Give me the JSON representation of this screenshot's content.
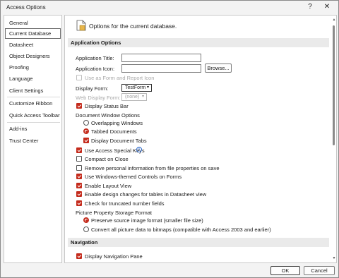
{
  "window": {
    "title": "Access Options",
    "help": "?",
    "close": "✕"
  },
  "sidebar": {
    "items": [
      {
        "label": "General"
      },
      {
        "label": "Current Database"
      },
      {
        "label": "Datasheet"
      },
      {
        "label": "Object Designers"
      },
      {
        "label": "Proofing"
      },
      {
        "label": "Language"
      },
      {
        "label": "Client Settings"
      },
      {
        "label": "Customize Ribbon"
      },
      {
        "label": "Quick Access Toolbar"
      },
      {
        "label": "Add-ins"
      },
      {
        "label": "Trust Center"
      }
    ],
    "active": "Current Database"
  },
  "header": {
    "text": "Options for the current database."
  },
  "app_options": {
    "heading": "Application Options",
    "app_title_label": "Application Title:",
    "app_title_value": "",
    "app_icon_label": "Application Icon:",
    "app_icon_value": "",
    "browse_label": "Browse...",
    "use_as_form_icon": "Use as Form and Report Icon",
    "display_form_label": "Display Form:",
    "display_form_value": "TestForm",
    "web_display_form_label": "Web Display Form:",
    "web_display_form_value": "(none)",
    "display_status_bar": "Display Status Bar",
    "doc_window_heading": "Document Window Options",
    "overlapping_windows": "Overlapping Windows",
    "tabbed_documents": "Tabbed Documents",
    "display_document_tabs": "Display Document Tabs",
    "use_access_keys": "Use Access Special Keys",
    "compact_on_close": "Compact on Close",
    "remove_personal_info": "Remove personal information from file properties on save",
    "windows_themed_controls": "Use Windows-themed Controls on Forms",
    "enable_layout_view": "Enable Layout View",
    "enable_design_changes": "Enable design changes for tables in Datasheet view",
    "check_truncated": "Check for truncated number fields",
    "picture_storage_heading": "Picture Property Storage Format",
    "preserve_source": "Preserve source image format (smaller file size)",
    "convert_bitmaps": "Convert all picture data to bitmaps (compatible with Access 2003 and earlier)"
  },
  "navigation": {
    "heading": "Navigation",
    "display_nav_pane": "Display Navigation Pane"
  },
  "footer": {
    "ok": "OK",
    "cancel": "Cancel"
  },
  "colors": {
    "accent": "#c42b1c",
    "info": "#2563c9"
  },
  "icons": {
    "help": "help-icon",
    "close": "close-icon",
    "info": "info-icon",
    "doc": "document-icon"
  }
}
